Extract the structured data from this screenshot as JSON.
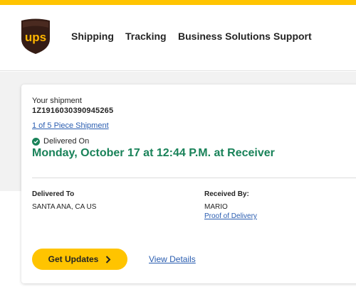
{
  "brand": {
    "logo_text": "ups",
    "accent_color": "#ffc400",
    "logo_shield_color": "#351c15",
    "logo_text_color": "#ffb500"
  },
  "nav": {
    "items": [
      {
        "label": "Shipping"
      },
      {
        "label": "Tracking"
      },
      {
        "label": "Business Solutions"
      },
      {
        "label": "Support"
      }
    ]
  },
  "shipment": {
    "heading": "Your shipment",
    "tracking_number": "1Z1916030390945265",
    "piece_link": "1 of 5 Piece Shipment",
    "status_label": "Delivered On",
    "status_icon": "check-circle-icon",
    "status_color": "#198259",
    "delivered_date": "Monday, October 17 at 12:44 P.M. at Receiver"
  },
  "details": {
    "delivered_to_label": "Delivered To",
    "delivered_to_value": "SANTA ANA, CA US",
    "received_by_label": "Received By:",
    "received_by_value": "MARIO",
    "proof_link": "Proof of Delivery"
  },
  "actions": {
    "get_updates_label": "Get Updates",
    "get_updates_icon": "chevron-right-icon",
    "view_details_label": "View Details"
  }
}
